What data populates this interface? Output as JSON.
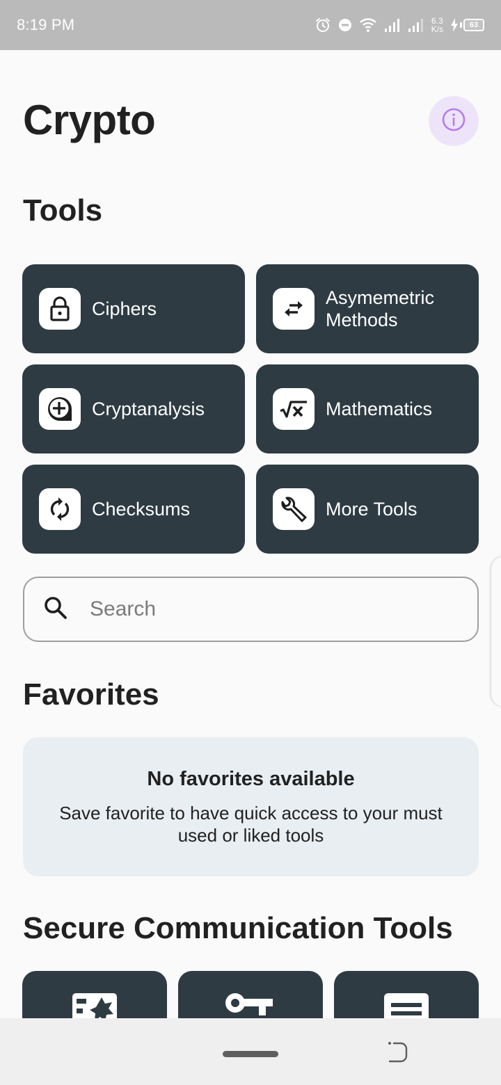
{
  "status_bar": {
    "time": "8:19 PM",
    "icons": [
      "alarm-icon",
      "dnd-icon",
      "wifi-icon",
      "signal-icon",
      "signal-icon"
    ],
    "net_speed_value": "6.3",
    "net_speed_unit": "K/s",
    "battery_level": "63",
    "charging": true
  },
  "header": {
    "title": "Crypto",
    "info_button_icon": "info-icon"
  },
  "tools": {
    "title": "Tools",
    "items": [
      {
        "label": "Ciphers",
        "icon": "lock-icon"
      },
      {
        "label": "Asymemetric Methods",
        "icon": "swap-arrows-icon"
      },
      {
        "label": "Cryptanalysis",
        "icon": "zoom-plus-icon"
      },
      {
        "label": "Mathematics",
        "icon": "square-root-icon"
      },
      {
        "label": "Checksums",
        "icon": "sync-icon"
      },
      {
        "label": "More Tools",
        "icon": "wrench-icon"
      }
    ]
  },
  "search": {
    "placeholder": "Search",
    "value": ""
  },
  "favorites": {
    "title": "Favorites",
    "empty_title": "No favorites available",
    "empty_description": "Save favorite to have quick access to your must used or liked tools"
  },
  "secure_communication": {
    "title": "Secure Communication Tools",
    "items": [
      {
        "icon": "badge-star-icon"
      },
      {
        "icon": "key-icon"
      },
      {
        "icon": "document-search-icon"
      }
    ]
  },
  "colors": {
    "card_background": "#2e3b43",
    "accent_info": "#b47cf0",
    "info_background": "#ede4fa",
    "favorites_background": "#e9eef2",
    "page_background": "#fafafa"
  }
}
